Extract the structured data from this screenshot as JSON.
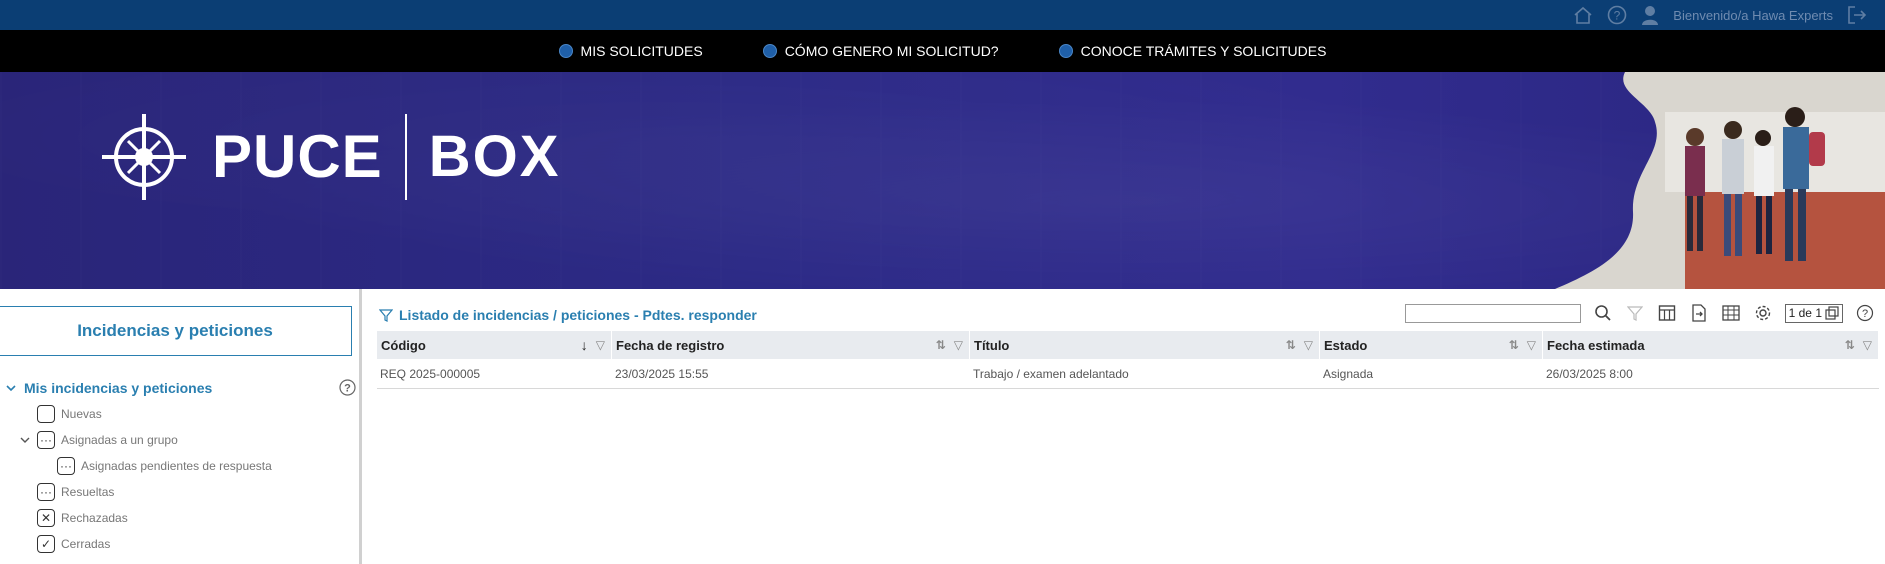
{
  "topbar": {
    "welcome": "Bienvenido/a Hawa Experts"
  },
  "nav": {
    "items": [
      {
        "label": "MIS SOLICITUDES"
      },
      {
        "label": "CÓMO GENERO MI SOLICITUD?"
      },
      {
        "label": "CONOCE TRÁMITES Y SOLICITUDES"
      }
    ]
  },
  "banner": {
    "logo_word": "PUCE",
    "logo_box": "BOX"
  },
  "sidebar": {
    "title": "Incidencias y peticiones",
    "tree_title": "Mis incidencias y peticiones",
    "items": [
      {
        "label": "Nuevas",
        "icon": "empty-box-icon"
      },
      {
        "label": "Asignadas a un grupo",
        "icon": "ellipsis-box-icon"
      },
      {
        "label": "Asignadas pendientes de respuesta",
        "icon": "ellipsis-box-icon"
      },
      {
        "label": "Resueltas",
        "icon": "ellipsis-box-icon"
      },
      {
        "label": "Rechazadas",
        "icon": "x-box-icon"
      },
      {
        "label": "Cerradas",
        "icon": "check-box-icon"
      }
    ]
  },
  "main": {
    "list_title": "Listado de incidencias / peticiones - Pdtes. responder",
    "search_value": "",
    "pager": "1 de 1",
    "columns": [
      "Código",
      "Fecha de registro",
      "Título",
      "Estado",
      "Fecha estimada"
    ],
    "rows": [
      [
        "REQ 2025-000005",
        "23/03/2025 15:55",
        "Trabajo / examen adelantado",
        "Asignada",
        "26/03/2025 8:00"
      ]
    ]
  },
  "colors": {
    "topbar": "#0b3e74",
    "navbar": "#000000",
    "banner": "#2c2a86",
    "accent": "#2a7fb0"
  }
}
